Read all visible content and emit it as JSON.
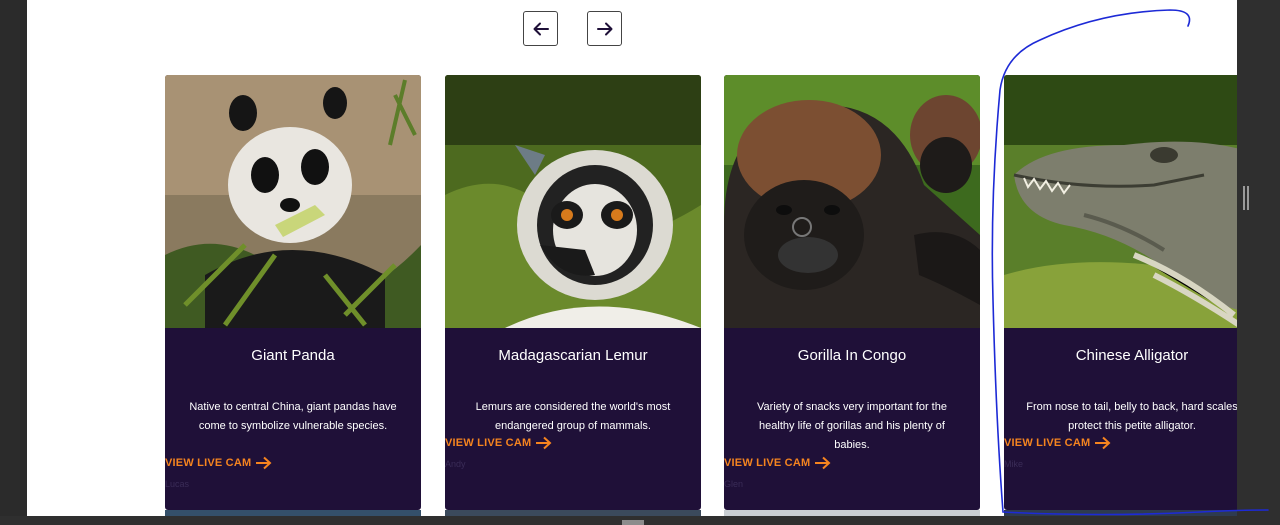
{
  "nav": {
    "prev_icon": "arrow-left-icon",
    "next_icon": "arrow-right-icon"
  },
  "colors": {
    "card_bg": "#1f1038",
    "accent": "#f5841f",
    "annotation": "#1d2ad6"
  },
  "cards": [
    {
      "title": "Giant Panda",
      "description": "Native to central China, giant pandas have come to symbolize vulnerable species.",
      "cta": "VIEW LIVE CAM",
      "author": "Lucas",
      "image": "giant-panda-photo"
    },
    {
      "title": "Madagascarian Lemur",
      "description": "Lemurs are considered the world's most endangered group of mammals.",
      "cta": "VIEW LIVE CAM",
      "author": "Andy",
      "image": "lemur-photo"
    },
    {
      "title": "Gorilla In Congo",
      "description": "Variety of snacks very important for the healthy life of gorillas and his plenty of babies.",
      "cta": "VIEW LIVE CAM",
      "author": "Glen",
      "image": "gorilla-photo"
    },
    {
      "title": "Chinese Alligator",
      "description": "From nose to tail, belly to back, hard scales protect this petite alligator.",
      "cta": "VIEW LIVE CAM",
      "author": "Mike",
      "image": "alligator-photo"
    }
  ]
}
